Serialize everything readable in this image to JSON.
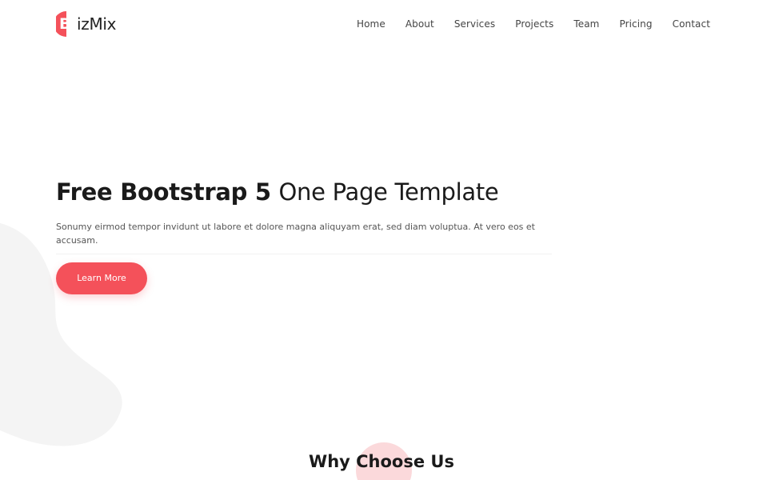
{
  "brand": {
    "logo_letter": "B",
    "logo_rest": "izMix",
    "accent_color": "#f4515a"
  },
  "nav": {
    "items": [
      {
        "label": "Home"
      },
      {
        "label": "About"
      },
      {
        "label": "Services"
      },
      {
        "label": "Projects"
      },
      {
        "label": "Team"
      },
      {
        "label": "Pricing"
      },
      {
        "label": "Contact"
      }
    ]
  },
  "hero": {
    "title_bold": "Free Bootstrap 5",
    "title_light": "One Page Template",
    "text": "Sonumy eirmod tempor invidunt ut labore et dolore magna aliquyam erat, sed diam voluptua. At vero eos et accusam.",
    "button_label": "Learn More"
  },
  "section": {
    "title": "Why Choose Us"
  }
}
